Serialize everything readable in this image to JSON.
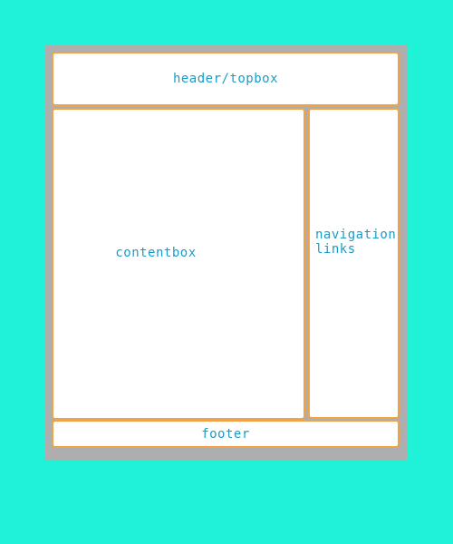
{
  "layout": {
    "header_label": "header/topbox",
    "content_label": "contentbox",
    "navigation_label": "navigation\nlinks",
    "footer_label": "footer"
  },
  "colors": {
    "background": "#1ff2d6",
    "frame": "#aeaeae",
    "box_fill": "#ffffff",
    "box_border": "#f0a348",
    "text": "#1a9cc9"
  }
}
